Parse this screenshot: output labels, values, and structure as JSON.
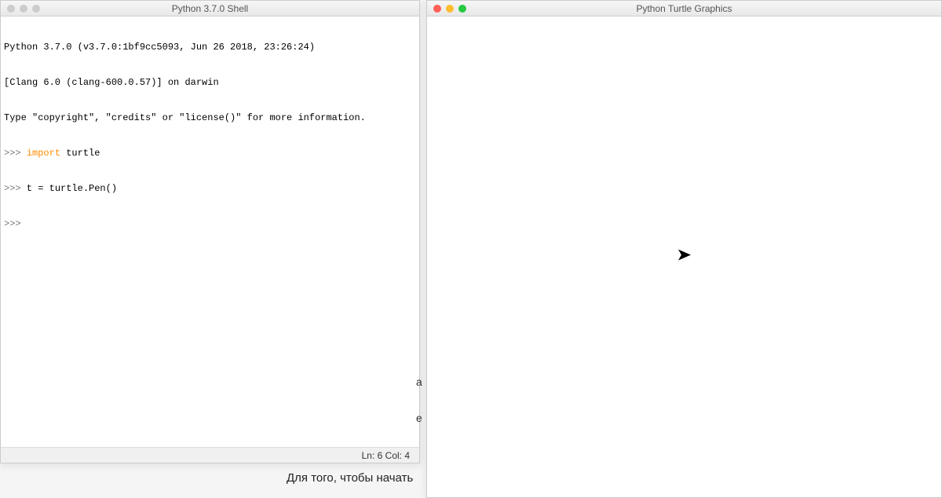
{
  "shell": {
    "title": "Python 3.7.0 Shell",
    "line1": "Python 3.7.0 (v3.7.0:1bf9cc5093, Jun 26 2018, 23:26:24)",
    "line2": "[Clang 6.0 (clang-600.0.57)] on darwin",
    "line3": "Type \"copyright\", \"credits\" or \"license()\" for more information.",
    "prompt": ">>>",
    "keyword_import": "import",
    "module_name": " turtle",
    "line5_code": " t = turtle.Pen()",
    "statusbar": "Ln: 6   Col: 4"
  },
  "turtle": {
    "title": "Python Turtle Graphics"
  },
  "bottom": {
    "text": "Для того, чтобы начать"
  },
  "partial": {
    "a": "a",
    "e": "e",
    "x": ""
  }
}
